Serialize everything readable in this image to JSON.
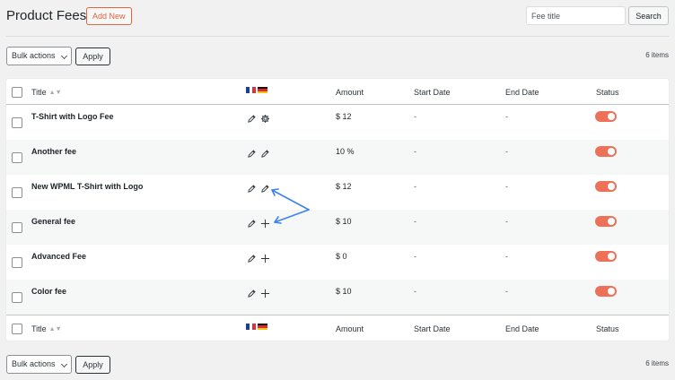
{
  "header": {
    "title": "Product Fees",
    "add_new_label": "Add New",
    "search_placeholder": "Fee title",
    "search_button_label": "Search"
  },
  "tablenav_top": {
    "bulk_label": "Bulk actions",
    "apply_label": "Apply",
    "items_count": "6 items"
  },
  "tablenav_bottom": {
    "bulk_label": "Bulk actions",
    "apply_label": "Apply",
    "items_count": "6 items"
  },
  "columns": {
    "title": "Title",
    "amount": "Amount",
    "start_date": "Start Date",
    "end_date": "End Date",
    "status": "Status"
  },
  "flags": [
    "fr-flag",
    "de-flag"
  ],
  "rows": [
    {
      "title": "T-Shirt with Logo Fee",
      "amount": "$ 12",
      "start_date": "-",
      "end_date": "-",
      "icons": [
        "pencil-icon",
        "gear-icon"
      ],
      "status_on": true
    },
    {
      "title": "Another fee",
      "amount": "10 %",
      "start_date": "-",
      "end_date": "-",
      "icons": [
        "pencil-icon",
        "pencil-icon"
      ],
      "status_on": true
    },
    {
      "title": "New WPML T-Shirt with Logo",
      "amount": "$ 12",
      "start_date": "-",
      "end_date": "-",
      "icons": [
        "pencil-icon",
        "pencil-icon"
      ],
      "status_on": true
    },
    {
      "title": "General fee",
      "amount": "$ 10",
      "start_date": "-",
      "end_date": "-",
      "icons": [
        "pencil-icon",
        "plus-icon"
      ],
      "status_on": true
    },
    {
      "title": "Advanced Fee",
      "amount": "$ 0",
      "start_date": "-",
      "end_date": "-",
      "icons": [
        "pencil-icon",
        "plus-icon"
      ],
      "status_on": true
    },
    {
      "title": "Color fee",
      "amount": "$ 10",
      "start_date": "-",
      "end_date": "-",
      "icons": [
        "pencil-icon",
        "plus-icon"
      ],
      "status_on": true
    }
  ],
  "colors": {
    "accent": "#ec7158",
    "annotation_arrow": "#3b82f6",
    "add_new": "#e5623d"
  }
}
